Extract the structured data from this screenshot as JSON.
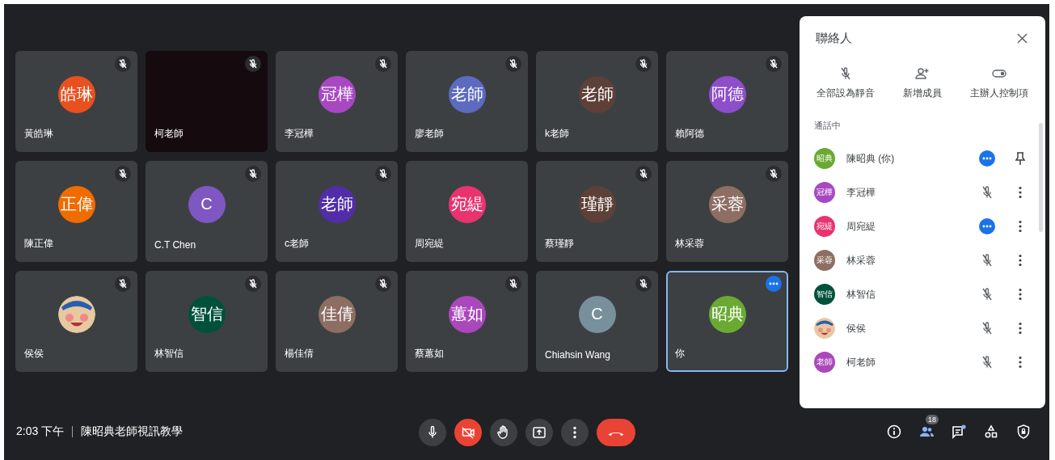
{
  "tiles": [
    {
      "name": "黃皓琳",
      "kind": "avatar",
      "initials": "皓琳",
      "color": "#e8501f",
      "muted": true,
      "more": false,
      "selected": false
    },
    {
      "name": "柯老師",
      "kind": "video",
      "muted": true,
      "more": false,
      "selected": false
    },
    {
      "name": "李冠樺",
      "kind": "avatar",
      "initials": "冠樺",
      "color": "#a748c2",
      "muted": true,
      "more": false,
      "selected": false
    },
    {
      "name": "廖老師",
      "kind": "avatar",
      "initials": "老師",
      "color": "#5c6bc0",
      "muted": true,
      "more": false,
      "selected": false
    },
    {
      "name": "k老師",
      "kind": "avatar",
      "initials": "老師",
      "color": "#5d4037",
      "muted": true,
      "more": false,
      "selected": false
    },
    {
      "name": "賴阿德",
      "kind": "avatar",
      "initials": "阿德",
      "color": "#8e4dc9",
      "muted": true,
      "more": false,
      "selected": false
    },
    {
      "name": "陳正偉",
      "kind": "avatar",
      "initials": "正偉",
      "color": "#ef6c00",
      "muted": true,
      "more": false,
      "selected": false
    },
    {
      "name": "C.T Chen",
      "kind": "avatar",
      "initials": "C",
      "color": "#7e57c2",
      "muted": true,
      "more": false,
      "selected": false
    },
    {
      "name": "c老師",
      "kind": "avatar",
      "initials": "老師",
      "color": "#512da8",
      "muted": true,
      "more": false,
      "selected": false
    },
    {
      "name": "周宛緹",
      "kind": "avatar",
      "initials": "宛緹",
      "color": "#e8336f",
      "muted": false,
      "more": false,
      "selected": false
    },
    {
      "name": "蔡瑾靜",
      "kind": "avatar",
      "initials": "瑾靜",
      "color": "#5d4037",
      "muted": true,
      "more": false,
      "selected": false
    },
    {
      "name": "林采蓉",
      "kind": "avatar",
      "initials": "采蓉",
      "color": "#8d6e63",
      "muted": true,
      "more": false,
      "selected": false
    },
    {
      "name": "侯侯",
      "kind": "picture",
      "muted": true,
      "more": false,
      "selected": false
    },
    {
      "name": "林智信",
      "kind": "avatar",
      "initials": "智信",
      "color": "#00513a",
      "muted": true,
      "more": false,
      "selected": false
    },
    {
      "name": "楊佳倩",
      "kind": "avatar",
      "initials": "佳倩",
      "color": "#8d6e63",
      "muted": true,
      "more": false,
      "selected": false
    },
    {
      "name": "蔡蕙如",
      "kind": "avatar",
      "initials": "蕙如",
      "color": "#ab47bc",
      "muted": true,
      "more": false,
      "selected": false
    },
    {
      "name": "Chiahsin Wang",
      "kind": "avatar",
      "initials": "C",
      "color": "#78909c",
      "muted": true,
      "more": false,
      "selected": false
    },
    {
      "name": "你",
      "kind": "avatar",
      "initials": "昭典",
      "color": "#6aaa32",
      "muted": false,
      "more": true,
      "selected": true
    }
  ],
  "panel": {
    "title": "聯絡人",
    "actions": [
      {
        "kind": "mute",
        "label": "全部設為靜音"
      },
      {
        "kind": "add",
        "label": "新增成員"
      },
      {
        "kind": "host",
        "label": "主辦人控制項"
      }
    ],
    "section": "通話中",
    "people": [
      {
        "name": "陳昭典 (你)",
        "kind": "avatar",
        "initials": "昭典",
        "color": "#6aaa32",
        "muted": false,
        "pinnable": true
      },
      {
        "name": "李冠樺",
        "kind": "avatar",
        "initials": "冠樺",
        "color": "#a748c2",
        "muted": true,
        "pinnable": false
      },
      {
        "name": "周宛緹",
        "kind": "avatar",
        "initials": "宛緹",
        "color": "#e8336f",
        "muted": false,
        "pinnable": false
      },
      {
        "name": "林采蓉",
        "kind": "avatar",
        "initials": "采蓉",
        "color": "#8d6e63",
        "muted": true,
        "pinnable": false
      },
      {
        "name": "林智信",
        "kind": "avatar",
        "initials": "智信",
        "color": "#00513a",
        "muted": true,
        "pinnable": false
      },
      {
        "name": "侯侯",
        "kind": "picture",
        "muted": true,
        "pinnable": false
      },
      {
        "name": "柯老師",
        "kind": "avatar",
        "initials": "老師",
        "color": "#ab47bc",
        "muted": true,
        "pinnable": false
      }
    ]
  },
  "bottom_bar": {
    "time": "2:03 下午",
    "meeting_title": "陳昭典老師視訊教學",
    "controls": [
      {
        "kind": "mic"
      },
      {
        "kind": "camera-off"
      },
      {
        "kind": "hand"
      },
      {
        "kind": "present"
      },
      {
        "kind": "more"
      },
      {
        "kind": "hangup"
      }
    ],
    "people_count": "18"
  }
}
